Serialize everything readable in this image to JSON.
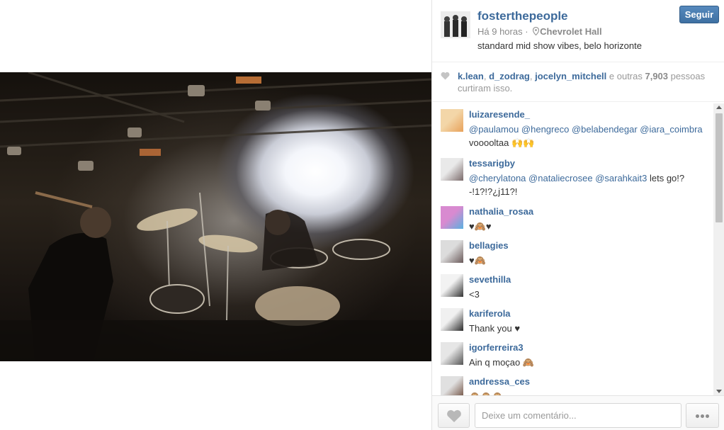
{
  "post": {
    "username": "fosterthepeople",
    "time": "Há 9 horas · ",
    "location": "Chevrolet Hall",
    "caption": "standard mid show vibes, belo horizonte",
    "follow_label": "Seguir"
  },
  "likes": {
    "users": [
      "k.lean",
      "d_zodrag",
      "jocelyn_mitchell"
    ],
    "sep1": ", ",
    "sep2": ", ",
    "and_others": " e outras ",
    "count": "7,903",
    "suffix": " pessoas curtiram isso."
  },
  "comments": [
    {
      "user": "luizaresende_",
      "parts": [
        {
          "t": "@paulamou",
          "m": true
        },
        {
          "t": " "
        },
        {
          "t": "@hengreco",
          "m": true
        },
        {
          "t": " "
        },
        {
          "t": "@belabendegar",
          "m": true
        },
        {
          "t": " "
        },
        {
          "t": "@iara_coimbra",
          "m": true
        },
        {
          "t": " vooooltaa 🙌🙌"
        }
      ]
    },
    {
      "user": "tessarigby",
      "parts": [
        {
          "t": "@cherylatona",
          "m": true
        },
        {
          "t": " "
        },
        {
          "t": "@nataliecrosee",
          "m": true
        },
        {
          "t": " "
        },
        {
          "t": "@sarahkait3",
          "m": true
        },
        {
          "t": " lets go!?-!1?!?¿j11?!"
        }
      ]
    },
    {
      "user": "nathalia_rosaa",
      "parts": [
        {
          "t": "♥🙈♥"
        }
      ]
    },
    {
      "user": "bellagies",
      "parts": [
        {
          "t": "♥🙈"
        }
      ]
    },
    {
      "user": "sevethilla",
      "parts": [
        {
          "t": "<3"
        }
      ]
    },
    {
      "user": "kariferola",
      "parts": [
        {
          "t": "Thank you ♥"
        }
      ]
    },
    {
      "user": "igorferreira3",
      "parts": [
        {
          "t": "Ain q moçao 🙈"
        }
      ]
    },
    {
      "user": "andressa_ces",
      "parts": [
        {
          "t": "🙈🙈🙈"
        }
      ]
    }
  ],
  "footer": {
    "comment_placeholder": "Deixe um comentário..."
  },
  "colors": {
    "link": "#3d6a9b",
    "follow_button": "#4a7db0"
  },
  "icons": [
    "pin-icon",
    "heart-icon",
    "like-heart-icon",
    "more-options-icon"
  ]
}
